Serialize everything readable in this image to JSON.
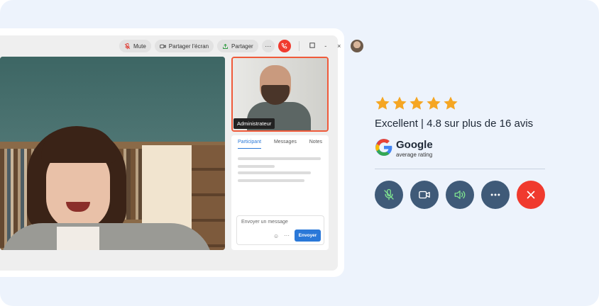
{
  "toolbar": {
    "mute_label": "Mute",
    "share_screen_label": "Partager l'écran",
    "share_label": "Partager",
    "more_label": "···",
    "minimize_label": "-",
    "close_label": "×"
  },
  "participant": {
    "label": "Administrateur"
  },
  "chat": {
    "tabs": [
      "Participant",
      "Messages",
      "Notes"
    ],
    "input_placeholder": "Envoyer un message",
    "send_label": "Envoyer",
    "more_label": "···"
  },
  "rating": {
    "stars": 5,
    "text": "Excellent | 4.8 sur plus de 16 avis",
    "brand": "Google",
    "sub": "average rating"
  },
  "colors": {
    "accent": "#2a78d8",
    "end_call": "#f03a2e",
    "control_bg": "#3f5a78",
    "star": "#f5a623",
    "active_speaker_border": "#f05a3a"
  },
  "icons": {
    "controls": [
      "mic-off-icon",
      "video-icon",
      "speaker-icon",
      "more-icon",
      "close-icon"
    ]
  }
}
